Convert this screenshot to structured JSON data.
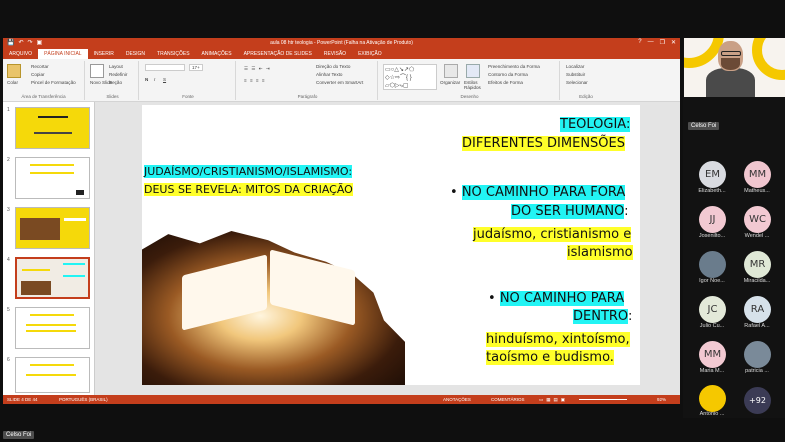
{
  "window": {
    "title": "aula 08 htr teologia - PowerPoint (Falha na Ativação de Produto)",
    "controls": [
      "?",
      "—",
      "❐",
      "✕"
    ],
    "quick_access": [
      "💾",
      "↶",
      "↷",
      "▣"
    ]
  },
  "tabs": [
    {
      "label": "ARQUIVO"
    },
    {
      "label": "PÁGINA INICIAL",
      "active": true
    },
    {
      "label": "INSERIR"
    },
    {
      "label": "DESIGN"
    },
    {
      "label": "TRANSIÇÕES"
    },
    {
      "label": "ANIMAÇÕES"
    },
    {
      "label": "APRESENTAÇÃO DE SLIDES"
    },
    {
      "label": "REVISÃO"
    },
    {
      "label": "EXIBIÇÃO"
    }
  ],
  "ribbon": {
    "clipboard": {
      "paste": "Colar",
      "cut": "Recortar",
      "copy": "Copiar",
      "format_painter": "Pincel de Formatação",
      "group": "Área de Transferência"
    },
    "slides": {
      "new_slide": "Novo Slide",
      "layout": "Layout",
      "reset": "Redefinir",
      "section": "Seção",
      "group": "Slides"
    },
    "font": {
      "group": "Fonte",
      "bold": "N",
      "italic": "I",
      "underline": "S",
      "size_value": "17+"
    },
    "paragraph": {
      "group": "Parágrafo",
      "text_direction": "Direção do Texto",
      "align_text": "Alinhar Texto",
      "smartart": "Converter em SmartArt"
    },
    "drawing": {
      "group": "Desenho",
      "arrange": "Organizar",
      "quick_styles": "Estilos Rápidos",
      "fill": "Preenchimento da Forma",
      "outline": "Contorno da Forma",
      "effects": "Efeitos de Forma"
    },
    "editing": {
      "group": "Edição",
      "find": "Localizar",
      "replace": "Substituir",
      "select": "Selecionar"
    }
  },
  "slide": {
    "title_line1": "TEOLOGIA:",
    "title_line2": "DIFERENTES DIMENSÕES",
    "left_line1": "JUDAÍSMO/CRISTIANISMO/ISLAMISMO:",
    "left_line2": "DEUS SE REVELA: MITOS DA CRIAÇÃO",
    "bullet1_line1": "NO CAMINHO PARA FORA",
    "bullet1_line2": "DO SER HUMANO",
    "bullet1_colon": ":",
    "bullet1_body1": "judaísmo, cristianismo e",
    "bullet1_body2": "islamismo",
    "bullet2_line1": "NO CAMINHO PARA",
    "bullet2_line2": "DENTRO",
    "bullet2_colon": ":",
    "bullet2_body1": "hinduísmo, xintoísmo,",
    "bullet2_body2": "taoísmo e budismo.",
    "bullet_glyph": "•"
  },
  "thumbnails": [
    {
      "number": "1"
    },
    {
      "number": "2"
    },
    {
      "number": "3"
    },
    {
      "number": "4",
      "selected": true
    },
    {
      "number": "5"
    },
    {
      "number": "6"
    }
  ],
  "statusbar": {
    "slide_info": "SLIDE 4 DE 44",
    "language": "PORTUGUÊS (BRASIL)",
    "notes": "ANOTAÇÕES",
    "comments": "COMENTÁRIOS",
    "zoom": "92%"
  },
  "meeting": {
    "presenter_name": "Celso Foi",
    "bottom_name": "Celso Foi",
    "participants": [
      {
        "initials": "EM",
        "name": "Elizabeth...",
        "color": "#d9dbe0"
      },
      {
        "initials": "MM",
        "name": "Matheus...",
        "color": "#f0c6cf"
      },
      {
        "initials": "JJ",
        "name": "Josenilto...",
        "color": "#f2c9d2"
      },
      {
        "initials": "WC",
        "name": "Wendel ...",
        "color": "#f2c9d2"
      },
      {
        "initials": "",
        "name": "Igor Noe...",
        "color": "#6a7c8c"
      },
      {
        "initials": "MR",
        "name": "Miracilda...",
        "color": "#dfe8d6"
      },
      {
        "initials": "JC",
        "name": "Julio Cu...",
        "color": "#e3e9d9"
      },
      {
        "initials": "RA",
        "name": "Rafael A...",
        "color": "#d6e1ea"
      },
      {
        "initials": "MM",
        "name": "Maria M...",
        "color": "#f2c9d2"
      },
      {
        "initials": "",
        "name": "patricia ...",
        "color": "#7a8a99"
      },
      {
        "initials": "",
        "name": "Antonio ...",
        "color": "#f5c800"
      },
      {
        "initials": "+92",
        "name": "",
        "color": "#3b3b55"
      }
    ]
  }
}
